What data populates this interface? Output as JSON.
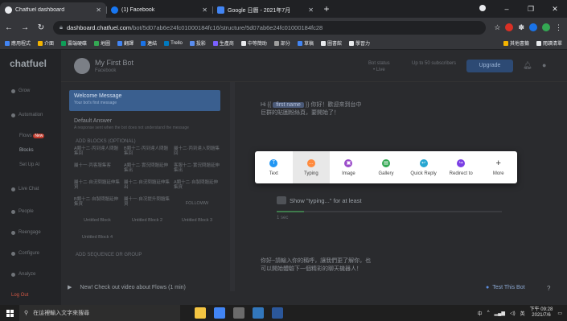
{
  "browser": {
    "tabs": [
      {
        "title": "Chatfuel dashboard",
        "color": "#e8eaed",
        "active": true
      },
      {
        "title": "(1) Facebook",
        "color": "#1877f2",
        "active": false
      },
      {
        "title": "Google 日曆 - 2021年7月",
        "color": "#4285f4",
        "active": false
      }
    ],
    "new_tab": "+",
    "url_host": "dashboard.chatfuel.com",
    "url_path": "/bot/5d07ab6e24fc01000184fc16/structure/5d07ab6e24fc01000184fc28",
    "bookmarks": [
      {
        "label": "應用程式",
        "color": "#4285f4"
      },
      {
        "label": "介面",
        "color": "#f4b400"
      },
      {
        "label": "雲端硬碟",
        "color": "#0f9d58"
      },
      {
        "label": "地圖",
        "color": "#34a853"
      },
      {
        "label": "翻譯",
        "color": "#4285f4"
      },
      {
        "label": "連結",
        "color": "#1a73e8"
      },
      {
        "label": "Trello",
        "color": "#0079bf"
      },
      {
        "label": "投影",
        "color": "#5a8dee"
      },
      {
        "label": "生產商",
        "color": "#7b61ff"
      },
      {
        "label": "中等簡助",
        "color": "#e8eaed"
      },
      {
        "label": "部分",
        "color": "#9e9e9e"
      },
      {
        "label": "草稿",
        "color": "#4285f4"
      },
      {
        "label": "圖書館",
        "color": "#e8eaed"
      },
      {
        "label": "學習力",
        "color": "#e8eaed"
      }
    ],
    "bookmarks_right": [
      {
        "label": "其他書籤",
        "color": "#f4b400"
      },
      {
        "label": "閱讀清單",
        "color": "#e8eaed"
      }
    ]
  },
  "app": {
    "logo": "chatfuel",
    "sidebar": {
      "items": [
        "Grow",
        "Automation",
        "Flows",
        "Blocks",
        "Set Up AI",
        "Live Chat",
        "People",
        "Reengage",
        "Configure",
        "Analyze"
      ],
      "flows_badge": "New",
      "logout": "Log Out"
    },
    "header": {
      "bot_name": "My First Bot",
      "bot_sub": "Facebook",
      "stat1_label": "Bot status",
      "stat1_value": "• Live",
      "stat2_label": "Up to 50 subscribers",
      "stat2_value": "",
      "upgrade": "Upgrade",
      "upgrade_color": "#2d4a74"
    },
    "blocks": {
      "selected": {
        "title": "Welcome Message",
        "sub": "Your bot's first message"
      },
      "default": {
        "title": "Default Answer",
        "sub": "A response sent when the bot does not understand the message"
      },
      "add_blocks": "ADD BLOCKS (OPTIONAL)",
      "cells": [
        "A類十二·丙到達人問題集回",
        "B類十二·丙到達人問題集回",
        "屬十二·丙到達入問題集回",
        "屬十一·丙客服集客",
        "A類十二·實況問題延伸集出",
        "客服十二·實況問題延伸集出",
        "屬十二·自況問題延伸集資",
        "屬十二·自況問題延伸集出",
        "A類十二·自製問題延伸集資",
        "B類十二·自製問題延伸集資",
        "屬十一·自况提升問題集資",
        "FOLLOWW",
        "Untitled Block",
        "Untitled Block 2",
        "Untitled Block 3",
        "Untitled Block 4",
        "",
        ""
      ],
      "sequence": "ADD SEQUENCE OR GROUP"
    },
    "news": "New! Check out video about Flows (1 min)",
    "canvas": {
      "msg1_prefix": "Hi {{",
      "msg1_tag": "first name",
      "msg1_rest": "}} 你好！歡迎來到台中巨群的貼圖粉絲頁，要開始了！",
      "typing": "Show \"typing...\" for at least",
      "typing_value": "1 sec",
      "typing_fill": 0.12,
      "msg2": "你好~請輸入你的稱呼，讓我們更了解你，也可以開始體驗下一個精彩的聊天機器人！",
      "test_bot": "Test This Bot",
      "help": "?"
    },
    "popup": {
      "items": [
        {
          "label": "Text",
          "icon": "text-icon",
          "color": "#2196f3",
          "glyph": "T"
        },
        {
          "label": "Typing",
          "icon": "typing-icon",
          "color": "#ff8a3d",
          "glyph": "…"
        },
        {
          "label": "Image",
          "icon": "image-icon",
          "color": "#9b4dca",
          "glyph": "▣"
        },
        {
          "label": "Gallery",
          "icon": "gallery-icon",
          "color": "#34a853",
          "glyph": "▤"
        },
        {
          "label": "Quick Reply",
          "icon": "quick-reply-icon",
          "color": "#26a6d1",
          "glyph": "↩"
        },
        {
          "label": "Redirect to",
          "icon": "redirect-icon",
          "color": "#7b3fe4",
          "glyph": "↪"
        },
        {
          "label": "More",
          "icon": "plus-icon",
          "color": "#333333",
          "glyph": "+"
        }
      ],
      "active_index": 1
    }
  },
  "taskbar": {
    "search_placeholder": "在這裡輸入文字來搜尋",
    "apps": [
      {
        "name": "file-explorer-icon",
        "color": "#f4c542"
      },
      {
        "name": "chrome-icon",
        "color": "#4285f4"
      },
      {
        "name": "photos-icon",
        "color": "#6b6b6b"
      },
      {
        "name": "edge-icon",
        "color": "#3277bc"
      },
      {
        "name": "word-icon",
        "color": "#2b579a"
      }
    ],
    "ime": "中",
    "lang": "英",
    "time": "下午 09:28",
    "date": "2021/7/6"
  }
}
